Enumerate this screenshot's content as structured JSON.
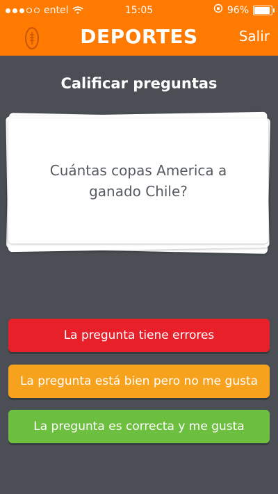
{
  "status_bar": {
    "carrier": "entel",
    "time": "15:05",
    "battery": "96%"
  },
  "header": {
    "title": "DEPORTES",
    "exit_label": "Salir",
    "category_icon": "football-icon"
  },
  "main": {
    "heading": "Calificar preguntas",
    "question": "Cuántas copas America a ganado Chile?"
  },
  "answers": [
    {
      "label": "La pregunta tiene errores",
      "color": "#e8202a"
    },
    {
      "label": "La pregunta está bien pero no me gusta",
      "color": "#f7a21c"
    },
    {
      "label": "La pregunta es correcta y me gusta",
      "color": "#6dbf3f"
    }
  ],
  "colors": {
    "header_bg": "#ff7a00",
    "page_bg": "#4b4f55"
  }
}
